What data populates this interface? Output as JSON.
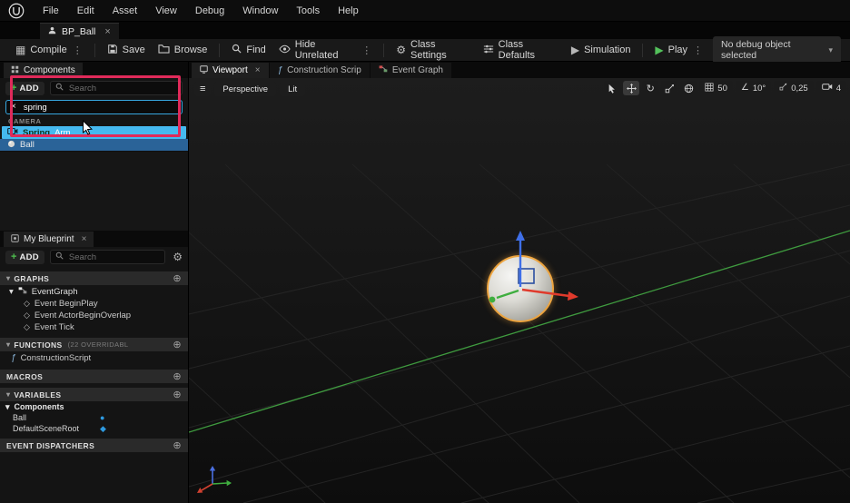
{
  "icons": {
    "kebab": "⋮",
    "chevron_down": "▾",
    "plus": "+",
    "close": "×",
    "gear": "⚙",
    "compile": "▦",
    "simulate": "▶",
    "play": "▶",
    "diamond": "◇",
    "fn": "ƒ",
    "plus_circle": "⊕",
    "rotate": "↻",
    "angle": "∠",
    "hamburger": "≡",
    "clear": "×",
    "dot": "●",
    "diamond_solid": "◆"
  },
  "menu": {
    "items": [
      "File",
      "Edit",
      "Asset",
      "View",
      "Debug",
      "Window",
      "Tools",
      "Help"
    ]
  },
  "asset_tab": {
    "label": "BP_Ball"
  },
  "toolbar": {
    "compile": "Compile",
    "save": "Save",
    "browse": "Browse",
    "find": "Find",
    "hide_unrelated": "Hide Unrelated",
    "class_settings": "Class Settings",
    "class_defaults": "Class Defaults",
    "simulation": "Simulation",
    "play": "Play",
    "debug_object": "No debug object selected"
  },
  "components": {
    "tab": "Components",
    "add": "ADD",
    "search_placeholder": "Search",
    "search_value": "spring",
    "dropdown_category": "CAMERA",
    "result_match": "Spring",
    "result_rest": " Arm",
    "selected_component": "Ball"
  },
  "my_blueprint": {
    "tab": "My Blueprint",
    "add": "ADD",
    "search_placeholder": "Search",
    "graphs_header": "GRAPHS",
    "eventgraph": "EventGraph",
    "events": [
      "Event BeginPlay",
      "Event ActorBeginOverlap",
      "Event Tick"
    ],
    "functions_header": "FUNCTIONS",
    "functions_note": "(22 OVERRIDABL",
    "construction_script": "ConstructionScript",
    "macros_header": "MACROS",
    "variables_header": "VARIABLES",
    "variables_category": "Components",
    "variables": [
      "Ball",
      "DefaultSceneRoot"
    ],
    "dispatchers_header": "EVENT DISPATCHERS"
  },
  "viewport": {
    "tab_viewport": "Viewport",
    "tab_construction": "Construction Scrip",
    "tab_eventgraph": "Event Graph",
    "perspective": "Perspective",
    "lit": "Lit",
    "snap_grid": "50",
    "snap_angle": "10°",
    "snap_scale": "0,25",
    "camera_speed": "4"
  }
}
